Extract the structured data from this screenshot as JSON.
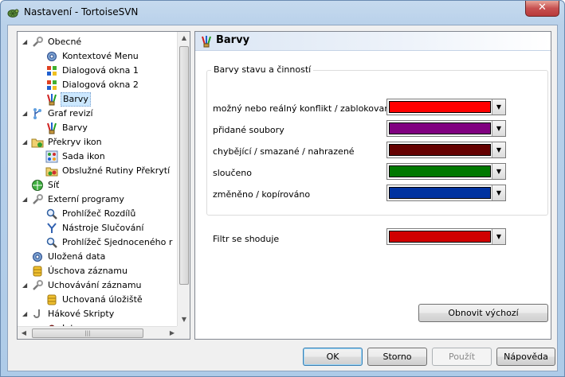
{
  "window": {
    "title": "Nastavení - TortoiseSVN",
    "close_label": "✕"
  },
  "tree": {
    "items": [
      {
        "label": "Obecné",
        "level": 0,
        "expanded": true,
        "icon": "wrench-icon"
      },
      {
        "label": "Kontextové Menu",
        "level": 1,
        "icon": "gear-icon"
      },
      {
        "label": "Dialogová okna 1",
        "level": 1,
        "icon": "windows-icon"
      },
      {
        "label": "Dialogová okna 2",
        "level": 1,
        "icon": "windows-icon"
      },
      {
        "label": "Barvy",
        "level": 1,
        "icon": "palette-icon",
        "selected": true
      },
      {
        "label": "Graf revizí",
        "level": 0,
        "expanded": true,
        "icon": "graph-icon"
      },
      {
        "label": "Barvy",
        "level": 1,
        "icon": "palette-icon"
      },
      {
        "label": "Překryv ikon",
        "level": 0,
        "expanded": true,
        "icon": "overlay-folder-icon"
      },
      {
        "label": "Sada ikon",
        "level": 1,
        "icon": "icon-set-icon"
      },
      {
        "label": "Obslužné Rutiny Překrytí",
        "level": 1,
        "icon": "overlay-handler-icon"
      },
      {
        "label": "Síť",
        "level": 0,
        "icon": "network-icon"
      },
      {
        "label": "Externí programy",
        "level": 0,
        "expanded": true,
        "icon": "wrench-icon"
      },
      {
        "label": "Prohlížeč Rozdílů",
        "level": 1,
        "icon": "magnifier-icon"
      },
      {
        "label": "Nástroje Slučování",
        "level": 1,
        "icon": "merge-icon"
      },
      {
        "label": "Prohlížeč Sjednoceného r",
        "level": 1,
        "icon": "magnifier-icon"
      },
      {
        "label": "Uložená data",
        "level": 0,
        "icon": "gear-icon"
      },
      {
        "label": "Úschova záznamu",
        "level": 0,
        "icon": "database-icon"
      },
      {
        "label": "Uchovávání záznamu",
        "level": 0,
        "expanded": true,
        "icon": "wrench-icon"
      },
      {
        "label": "Uchovaná úložiště",
        "level": 1,
        "icon": "database-icon"
      },
      {
        "label": "Hákové Skripty",
        "level": 0,
        "expanded": true,
        "icon": "hook-icon"
      },
      {
        "label": "Integrace s programem p",
        "level": 1,
        "icon": "bug-icon"
      }
    ],
    "hscroll_grip": "|||"
  },
  "panel": {
    "title": "Barvy",
    "group_title": "Barvy stavu a činností",
    "rows": [
      {
        "label": "možný nebo reálný konflikt / zablokovaný",
        "color": "#ff0000"
      },
      {
        "label": "přidané soubory",
        "color": "#800080"
      },
      {
        "label": "chybějící / smazané / nahrazené",
        "color": "#640000"
      },
      {
        "label": "sloučeno",
        "color": "#007800"
      },
      {
        "label": "změněno / kopírováno",
        "color": "#0032a0"
      }
    ],
    "filter": {
      "label": "Filtr se shoduje",
      "color": "#d00000"
    },
    "reset_label": "Obnovit výchozí"
  },
  "buttons": {
    "ok": "OK",
    "cancel": "Storno",
    "apply": "Použít",
    "help": "Nápověda"
  },
  "colors": {
    "accent": "#3c7fb1",
    "selection": "#cce8ff"
  }
}
